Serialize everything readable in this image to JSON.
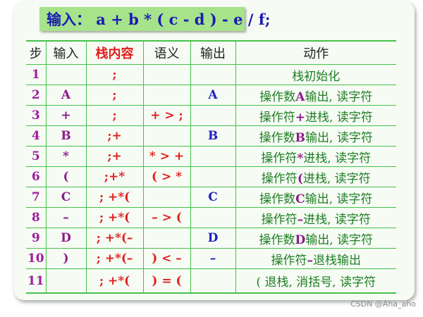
{
  "title": "输入： a + b * ( c - d ) - e / f;",
  "table": {
    "headers": [
      "步",
      "输入",
      "栈内容",
      "语义",
      "输出",
      "动作"
    ],
    "rows": [
      {
        "step": "1",
        "input": "",
        "stack": ";",
        "semantic": "",
        "output": "",
        "action": [
          "栈初始化",
          "",
          ""
        ]
      },
      {
        "step": "2",
        "input": "A",
        "stack": ";",
        "semantic": "",
        "output": "A",
        "action": [
          "操作数",
          "A",
          "输出, 读字符"
        ]
      },
      {
        "step": "3",
        "input": "+",
        "stack": ";",
        "semantic": "+ > ;",
        "output": "",
        "action": [
          "操作符",
          "+",
          "进栈, 读字符"
        ]
      },
      {
        "step": "4",
        "input": "B",
        "stack": ";+",
        "semantic": "",
        "output": "B",
        "action": [
          "操作数",
          "B",
          "输出, 读字符"
        ]
      },
      {
        "step": "5",
        "input": "*",
        "stack": ";+",
        "semantic": "* > +",
        "output": "",
        "action": [
          "操作符",
          "*",
          "进栈, 读字符"
        ]
      },
      {
        "step": "6",
        "input": "(",
        "stack": ";+*",
        "semantic": "( > *",
        "output": "",
        "action": [
          "操作符",
          "(",
          "进栈, 读字符"
        ]
      },
      {
        "step": "7",
        "input": "C",
        "stack": "; +*(",
        "semantic": "",
        "output": "C",
        "action": [
          "操作数",
          "C",
          "输出, 读字符"
        ]
      },
      {
        "step": "8",
        "input": "–",
        "stack": "; +*(",
        "semantic": "– > (",
        "output": "",
        "action": [
          "操作符",
          "–",
          "进栈, 读字符"
        ]
      },
      {
        "step": "9",
        "input": "D",
        "stack": "; +*(–",
        "semantic": "",
        "output": "D",
        "action": [
          "操作数",
          "D",
          "输出, 读字符"
        ]
      },
      {
        "step": "10",
        "input": ")",
        "stack": "; +*(–",
        "semantic": ") < –",
        "output": "–",
        "action": [
          "操作符",
          "–",
          "退栈输出"
        ]
      },
      {
        "step": "11",
        "input": "",
        "stack": "; +*(",
        "semantic": ") = (",
        "output": "",
        "action": [
          "(",
          "",
          " 退栈, 消括号, 读字符"
        ]
      }
    ]
  },
  "watermark": "CSDN @Aha_aho"
}
